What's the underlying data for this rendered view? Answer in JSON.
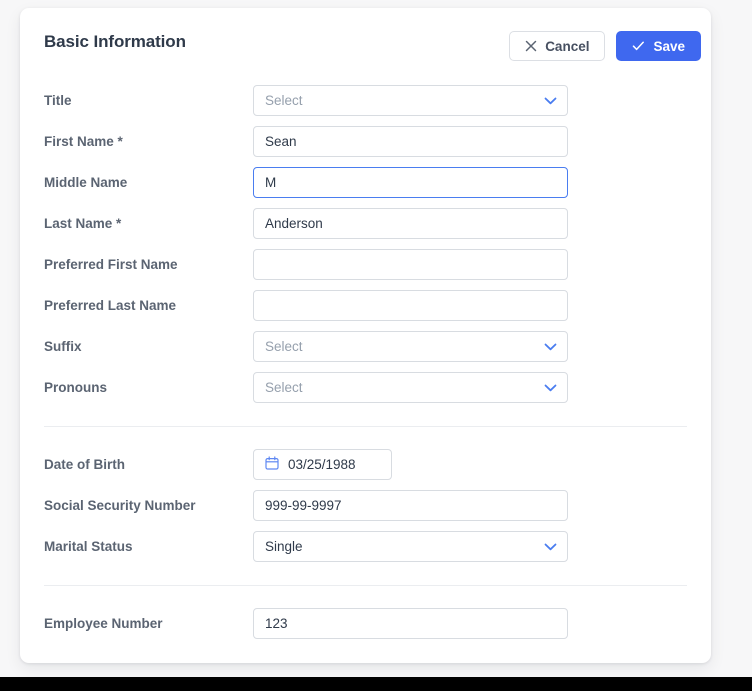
{
  "card": {
    "title": "Basic Information",
    "actions": [
      {
        "label": "Cancel",
        "icon": "close-icon",
        "style": "secondary"
      },
      {
        "label": "Save",
        "icon": "check-icon",
        "style": "primary"
      }
    ]
  },
  "colors": {
    "primary": "#3f68ef",
    "chevron": "#4a7df0",
    "label": "#5b6472",
    "value": "#2f3a4a",
    "placeholder": "#96a0ad",
    "border": "#d8dce1",
    "focus_border": "#4a7df0",
    "page_background": "#f7f7f8",
    "card_background": "#ffffff",
    "divider": "#ebedf0"
  },
  "groups": [
    {
      "name": "name-group",
      "fields": [
        {
          "name": "title",
          "label": "Title",
          "type": "select",
          "value": "",
          "placeholder": "Select",
          "focused": false,
          "required": false
        },
        {
          "name": "first-name",
          "label": "First Name *",
          "type": "text",
          "value": "Sean",
          "placeholder": "",
          "focused": false,
          "required": true
        },
        {
          "name": "middle-name",
          "label": "Middle Name",
          "type": "text",
          "value": "M",
          "placeholder": "",
          "focused": true,
          "required": false
        },
        {
          "name": "last-name",
          "label": "Last Name *",
          "type": "text",
          "value": "Anderson",
          "placeholder": "",
          "focused": false,
          "required": true
        },
        {
          "name": "preferred-first-name",
          "label": "Preferred First Name",
          "type": "text",
          "value": "",
          "placeholder": "",
          "focused": false,
          "required": false
        },
        {
          "name": "preferred-last-name",
          "label": "Preferred Last Name",
          "type": "text",
          "value": "",
          "placeholder": "",
          "focused": false,
          "required": false
        },
        {
          "name": "suffix",
          "label": "Suffix",
          "type": "select",
          "value": "",
          "placeholder": "Select",
          "focused": false,
          "required": false
        },
        {
          "name": "pronouns",
          "label": "Pronouns",
          "type": "select",
          "value": "",
          "placeholder": "Select",
          "focused": false,
          "required": false
        }
      ]
    },
    {
      "name": "personal-group",
      "fields": [
        {
          "name": "date-of-birth",
          "label": "Date of Birth",
          "type": "date",
          "value": "03/25/1988",
          "placeholder": "",
          "focused": false,
          "required": false,
          "icon": "calendar-icon"
        },
        {
          "name": "social-security-number",
          "label": "Social Security Number",
          "type": "text",
          "value": "999-99-9997",
          "placeholder": "",
          "focused": false,
          "required": false
        },
        {
          "name": "marital-status",
          "label": "Marital Status",
          "type": "select",
          "value": "Single",
          "placeholder": "",
          "focused": false,
          "required": false
        }
      ]
    },
    {
      "name": "employment-group",
      "fields": [
        {
          "name": "employee-number",
          "label": "Employee Number",
          "type": "text",
          "value": "123",
          "placeholder": "",
          "focused": false,
          "required": false
        }
      ]
    }
  ]
}
